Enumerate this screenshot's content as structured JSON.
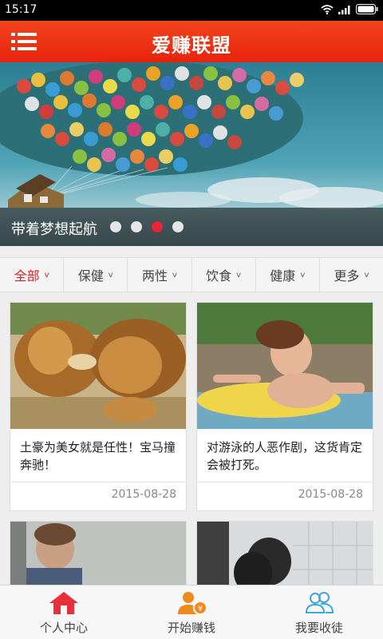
{
  "status_bar": {
    "time": "15:17"
  },
  "app_bar": {
    "title": "爱赚联盟",
    "menu_icon": "menu-icon"
  },
  "banner": {
    "caption": "带着梦想起航",
    "dots_total": 4,
    "active_dot": 3
  },
  "tabs": [
    {
      "label": "全部",
      "active": true
    },
    {
      "label": "保健"
    },
    {
      "label": "两性"
    },
    {
      "label": "饮食"
    },
    {
      "label": "健康"
    },
    {
      "label": "更多"
    }
  ],
  "cards": [
    {
      "text": "土豪为美女就是任性！宝马撞奔驰！",
      "date": "2015-08-28"
    },
    {
      "text": "对游泳的人恶作剧，这货肯定会被打死。",
      "date": "2015-08-28"
    }
  ],
  "bottom_nav": [
    {
      "label": "个人中心",
      "icon": "home-icon"
    },
    {
      "label": "开始赚钱",
      "icon": "earn-money-icon"
    },
    {
      "label": "我要收徒",
      "icon": "users-icon"
    }
  ],
  "colors": {
    "accent": "#e8230d",
    "active_tab": "#d8222a",
    "active_dot": "#e8233a"
  }
}
